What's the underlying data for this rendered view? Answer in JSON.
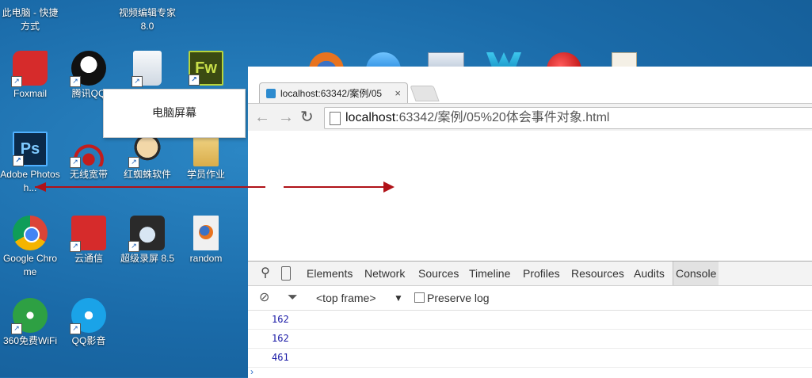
{
  "desktop": {
    "icons": [
      {
        "label": "此电脑 - 快捷方式",
        "icon": "computer-shortcut-icon",
        "color": "#3a7bd5"
      },
      {
        "label": "视频编辑专家 8.0",
        "icon": "video-editor-icon",
        "color": "#e07a1f"
      },
      {
        "label": "Foxmail",
        "icon": "foxmail-icon",
        "color": "#d62b2b"
      },
      {
        "label": "腾讯QQ",
        "icon": "qq-icon",
        "color": "#111111"
      },
      {
        "label": "",
        "icon": "recycle-bin-icon",
        "color": "#e9eef3"
      },
      {
        "label": "",
        "icon": "fireworks-icon",
        "color": "#3b4a12"
      },
      {
        "label": "Adobe Photosh...",
        "icon": "photoshop-icon",
        "color": "#0b2a4a"
      },
      {
        "label": "无线宽带",
        "icon": "wireless-icon",
        "color": "#c21d1d"
      },
      {
        "label": "红蜘蛛软件",
        "icon": "red-spider-icon",
        "color": "#f2d7a8"
      },
      {
        "label": "学员作业",
        "icon": "folder-icon",
        "color": "#e8c46a"
      },
      {
        "label": "Google Chrome",
        "icon": "chrome-icon",
        "color": "#34a853"
      },
      {
        "label": "云通信",
        "icon": "cloud-comm-icon",
        "color": "#d62b2b"
      },
      {
        "label": "超级录屏 8.5",
        "icon": "screen-recorder-icon",
        "color": "#2a2a2a"
      },
      {
        "label": "random",
        "icon": "firefox-file-icon",
        "color": "#f0f0f0"
      },
      {
        "label": "360免费WiFi",
        "icon": "wifi-360-icon",
        "color": "#2ea043"
      },
      {
        "label": "QQ影音",
        "icon": "qq-player-icon",
        "color": "#1aa3e8"
      }
    ]
  },
  "tooltip": {
    "text": "电脑屏幕"
  },
  "browser": {
    "tab_title": "localhost:63342/案例/05",
    "tab_close": "×",
    "url_host": "localhost",
    "url_rest": ":63342/案例/05%20体会事件对象.html"
  },
  "devtools": {
    "tabs": [
      "Elements",
      "Network",
      "Sources",
      "Timeline",
      "Profiles",
      "Resources",
      "Audits",
      "Console"
    ],
    "active_tab": "Console",
    "frame_select": "<top frame>",
    "preserve_log": "Preserve log",
    "log": [
      "162",
      "162",
      "461"
    ]
  },
  "colors": {
    "desktop": "#1f6fae",
    "arrow": "#b01218",
    "log_text": "#1a1aa6"
  }
}
